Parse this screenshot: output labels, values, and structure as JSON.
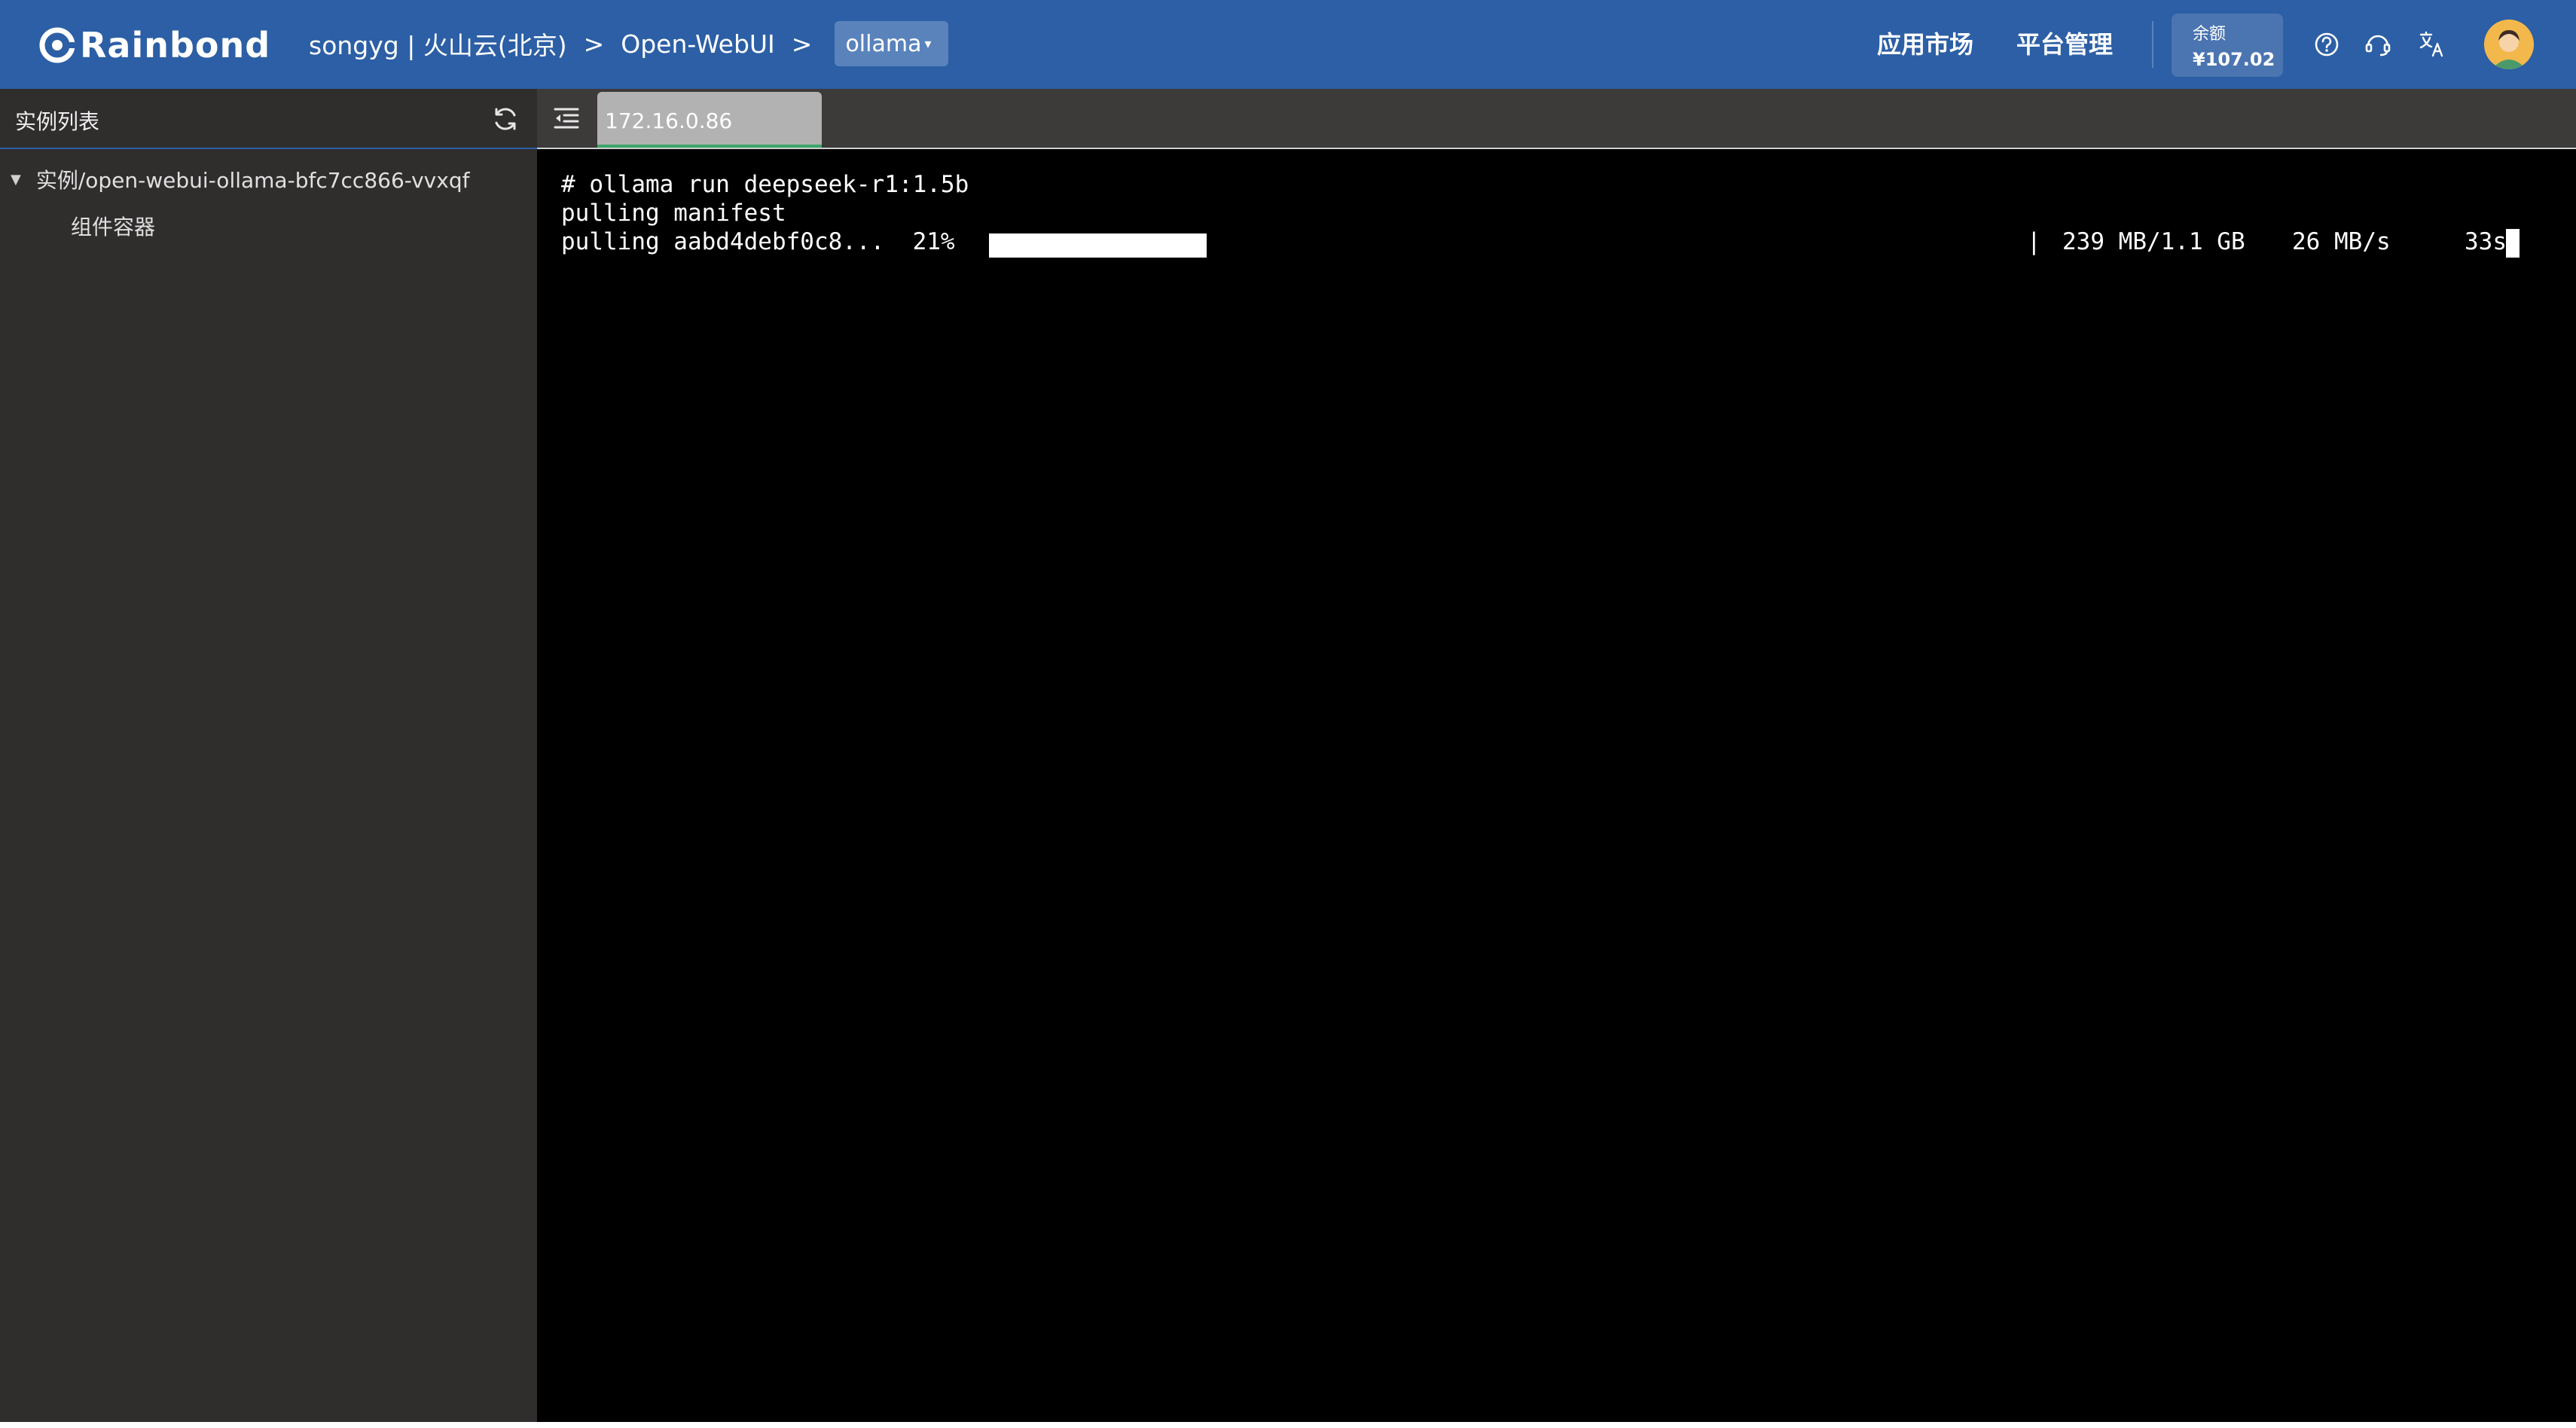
{
  "header": {
    "brand": "Rainbond",
    "breadcrumb": {
      "team": "songyg | 火山云(北京)",
      "sep1": ">",
      "app": "Open-WebUI",
      "sep2": ">",
      "component": "ollama"
    },
    "nav": {
      "market": "应用市场",
      "platform": "平台管理"
    },
    "balance": {
      "label": "余额",
      "value": "¥107.02"
    },
    "icons": [
      "help-circle-icon",
      "headset-support-icon",
      "translate-icon",
      "user-avatar"
    ]
  },
  "sidebar": {
    "title": "实例列表",
    "tree": {
      "instance": "实例/open-webui-ollama-bfc7cc866-vvxqf",
      "child": "组件容器"
    }
  },
  "tabs": [
    {
      "label": "172.16.0.86",
      "active": true
    }
  ],
  "terminal": {
    "lines": {
      "cmd": "# ollama run deepseek-r1:1.5b",
      "manifest": "pulling manifest",
      "pull_prefix": "pulling aabd4debf0c8...  21%"
    },
    "progress": {
      "percent": 21,
      "separator": "|",
      "size": "239 MB/1.1 GB",
      "speed": "26 MB/s",
      "eta": "33s"
    }
  },
  "colors": {
    "header_bg": "#2c5fa5",
    "sidebar_bg": "#302d2d",
    "terminal_bg": "#000000",
    "tab_bg": "#b2b2b2",
    "tab_active_border": "#3aa66a"
  }
}
